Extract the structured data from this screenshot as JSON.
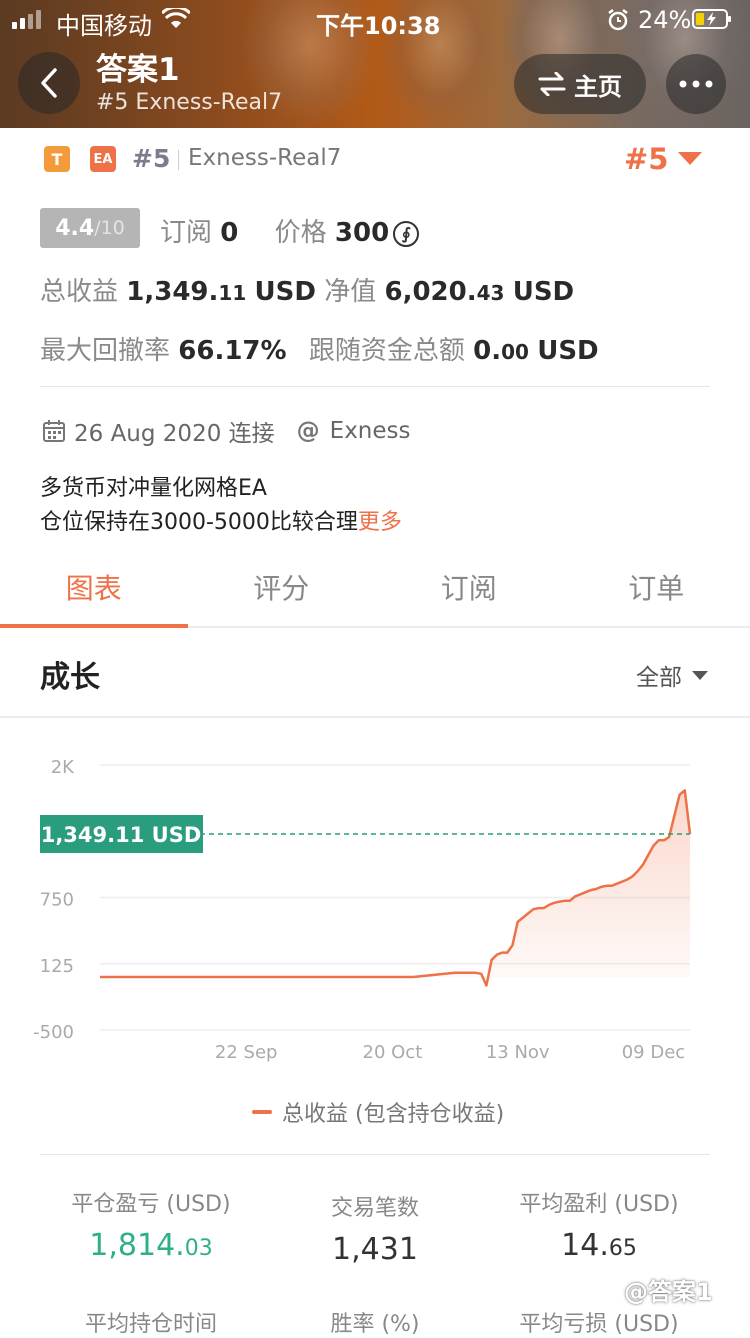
{
  "status_bar": {
    "carrier": "中国移动",
    "time": "下午10:38",
    "battery": "24%"
  },
  "header": {
    "title": "答案1",
    "subtitle": "#5 Exness-Real7",
    "home_label": "主页"
  },
  "account": {
    "badge_t": "T",
    "badge_ea": "EA",
    "rank": "#5",
    "name": "Exness-Real7",
    "rank_big": "#5",
    "score": "4.4",
    "score_max": "/10",
    "subscribe_label": "订阅",
    "subscribe_count": "0",
    "price_label": "价格",
    "price": "300",
    "coin_symbol": "∮",
    "total_profit_label": "总收益",
    "total_profit_int": "1,349.",
    "total_profit_dec": "11",
    "total_profit_unit": "USD",
    "equity_label": "净值",
    "equity_int": "6,020.",
    "equity_dec": "43",
    "equity_unit": "USD",
    "drawdown_label": "最大回撤率",
    "drawdown": "66.17%",
    "follow_label": "跟随资金总额",
    "follow_int": "0.",
    "follow_dec": "00",
    "follow_unit": "USD",
    "date": "26 Aug 2020 连接",
    "broker": "Exness",
    "desc_line1": "多货币对冲量化网格EA",
    "desc_line2": "仓位保持在3000-5000比较合理",
    "more_label": "更多"
  },
  "tabs": [
    {
      "label": "图表",
      "active": true
    },
    {
      "label": "评分",
      "active": false
    },
    {
      "label": "订阅",
      "active": false
    },
    {
      "label": "订单",
      "active": false
    }
  ],
  "section": {
    "title": "成长",
    "range": "全部"
  },
  "chart_data": {
    "type": "area",
    "ytick_labels": [
      "2K",
      "750",
      "125",
      "-500"
    ],
    "yticks": [
      2000,
      750,
      125,
      -500
    ],
    "xtick_labels": [
      "22 Sep",
      "20 Oct",
      "13 Nov",
      "09 Dec"
    ],
    "xticks": [
      28,
      56,
      80,
      106
    ],
    "ylim": [
      -500,
      2000
    ],
    "xlim": [
      0,
      113
    ],
    "current_label": "1,349.11 USD",
    "current_value": 1349.11,
    "series": [
      {
        "name": "总收益 (包含持仓收益)",
        "x": [
          0,
          10,
          20,
          30,
          40,
          50,
          60,
          64,
          66,
          68,
          70,
          72,
          73,
          74,
          75,
          76,
          77,
          78,
          79,
          80,
          81,
          82,
          83,
          84,
          85,
          86,
          87,
          88,
          89,
          90,
          91,
          92,
          93,
          94,
          95,
          96,
          97,
          98,
          99,
          100,
          101,
          102,
          103,
          104,
          105,
          106,
          107,
          108,
          109,
          110,
          111,
          112,
          113
        ],
        "y": [
          0,
          0,
          0,
          0,
          0,
          0,
          0,
          20,
          30,
          40,
          40,
          40,
          30,
          -80,
          160,
          210,
          230,
          230,
          300,
          520,
          560,
          600,
          640,
          650,
          650,
          680,
          700,
          710,
          720,
          720,
          760,
          780,
          800,
          820,
          830,
          850,
          860,
          860,
          880,
          900,
          920,
          950,
          1000,
          1060,
          1150,
          1240,
          1290,
          1290,
          1320,
          1520,
          1720,
          1760,
          1349.11
        ]
      }
    ],
    "grid": true,
    "legend": "bottom"
  },
  "stats": [
    {
      "label": "平仓盈亏 (USD)",
      "int": "1,814.",
      "dec": "03",
      "color": "#2fae8a"
    },
    {
      "label": "交易笔数",
      "int": "1,431",
      "dec": "",
      "color": "#333333"
    },
    {
      "label": "平均盈利 (USD)",
      "int": "14.",
      "dec": "65",
      "color": "#333333"
    },
    {
      "label": "平均持仓时间",
      "int": "",
      "dec": "",
      "color": "#333333"
    },
    {
      "label": "胜率 (%)",
      "int": "",
      "dec": "",
      "color": "#333333"
    },
    {
      "label": "平均亏损 (USD)",
      "int": "",
      "dec": "",
      "color": "#333333"
    }
  ],
  "watermark": "@答案1",
  "colors": {
    "accent": "#ee7148",
    "green_label": "#2a9d7e",
    "profit_green": "#2fae8a"
  }
}
